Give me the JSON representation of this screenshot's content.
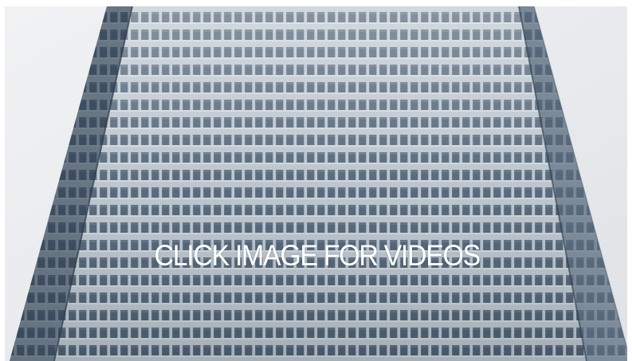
{
  "promo": {
    "caption": "CLICK IMAGE FOR VIDEOS",
    "photo_subject": "glass-office-tower-facade",
    "colors": {
      "sky": "#e9ebee",
      "glass": "#46586a",
      "mullion": "#c7d0d8",
      "caption": "#ffffff"
    }
  }
}
